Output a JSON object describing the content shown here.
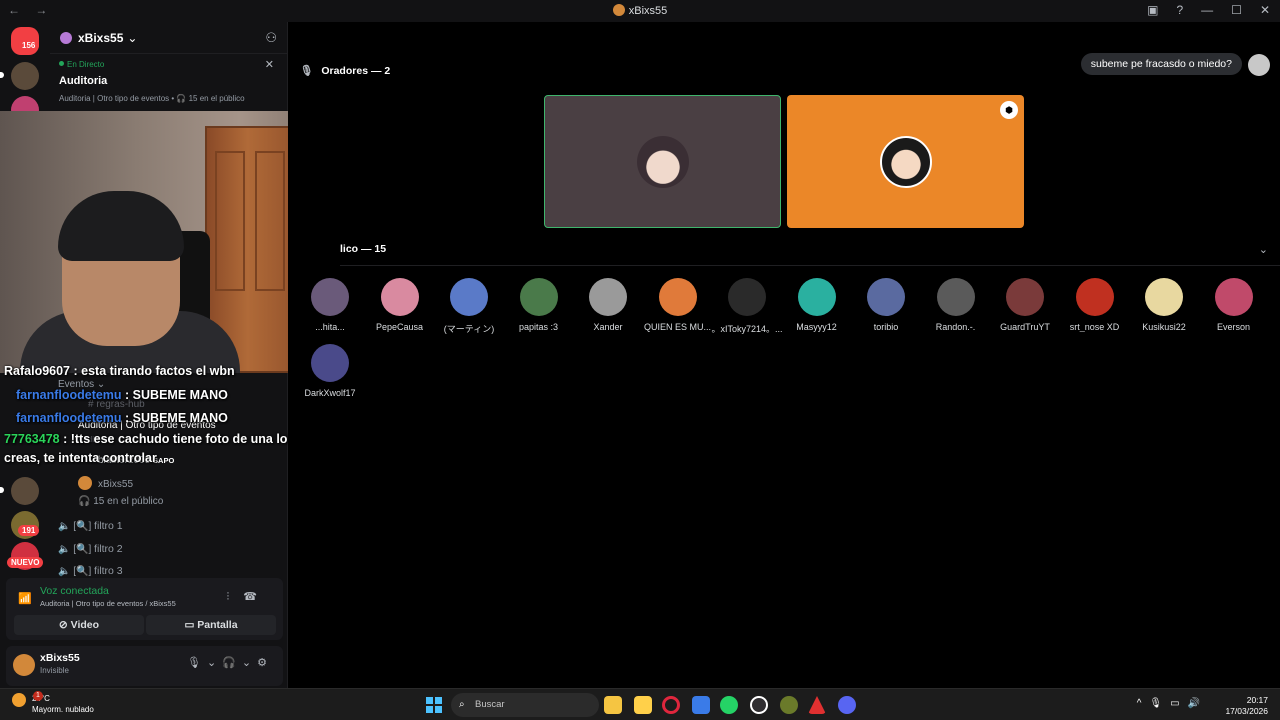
{
  "window": {
    "nav_arrows": "←  →",
    "title": "xBixs55",
    "controls": [
      "▣",
      "?",
      "—",
      "☐",
      "✕"
    ]
  },
  "guilds": {
    "badges": [
      "156",
      "191"
    ],
    "new_label": "NUEVO"
  },
  "server": {
    "name": "xBixs55",
    "chevron": "⌄"
  },
  "stage_banner": {
    "live_label": "En Directo",
    "title": "Auditoria",
    "subtitle": "Auditoria | Otro tipo de eventos • 🎧 15 en el público"
  },
  "channels": {
    "category": "Eventos",
    "rules": "regras-hub",
    "stage_row": "Auditoria | Otro tipo de eventos",
    "stage_small": "Auditoria",
    "member1": "blaster2005",
    "member1_tag": "SAPO",
    "member2": "xBixs55",
    "audience": "15 en el público",
    "filters": [
      "filtro 1",
      "filtro 2",
      "filtro 3"
    ]
  },
  "chat_overlay": [
    {
      "user": "Rafalo9607",
      "text": " : esta tirando factos el wbn"
    },
    {
      "user": "farnanfloodetemu",
      "text": " : SUBEME MANO"
    },
    {
      "user": "farnanfloodetemu",
      "text": " : SUBEME MANO"
    },
    {
      "user": "77763478",
      "text": " : !tts ese cachudo tiene foto de una loli, no le creas, te intenta controlar"
    }
  ],
  "voice": {
    "status": "Voz conectada",
    "detail": "Auditoria | Otro tipo de eventos / xBixs55",
    "video_label": "Video",
    "screen_label": "Pantalla"
  },
  "user_panel": {
    "name": "xBixs55",
    "status": "Invisible"
  },
  "stage": {
    "speakers_label": "Oradores — 2",
    "audience_label": "lico — 15",
    "bubble": "subeme pe fracasdo o miedo?"
  },
  "audience": [
    {
      "name": "...hita...",
      "color": "#6a5a7a"
    },
    {
      "name": "PepeCausa",
      "color": "#d98aa0"
    },
    {
      "name": "(マーティン)",
      "color": "#5a7ac8"
    },
    {
      "name": "papitas :3",
      "color": "#4a7a4a"
    },
    {
      "name": "Xander",
      "color": "#9a9a9a"
    },
    {
      "name": "QUIEN ES MU...",
      "color": "#e07a3a"
    },
    {
      "name": "。xIToky7214。...",
      "color": "#2a2a2a"
    },
    {
      "name": "Masyyy12",
      "color": "#2ab0a0"
    },
    {
      "name": "toribio",
      "color": "#5a6aa0"
    },
    {
      "name": "Randon.-.",
      "color": "#5a5a5a"
    },
    {
      "name": "GuardTruYT",
      "color": "#7a3a3a"
    },
    {
      "name": "srt_nose XD",
      "color": "#c03020"
    },
    {
      "name": "Kusikusi22",
      "color": "#e8d8a0"
    },
    {
      "name": "Everson",
      "color": "#c04a6a"
    },
    {
      "name": "DarkXwolf17",
      "color": "#4a4a8a"
    }
  ],
  "taskbar": {
    "temp": "24°C",
    "weather": "Mayorm. nublado",
    "weather_badge": "1",
    "search_placeholder": "Buscar",
    "time": "20:17",
    "date": "17/03/2026"
  }
}
